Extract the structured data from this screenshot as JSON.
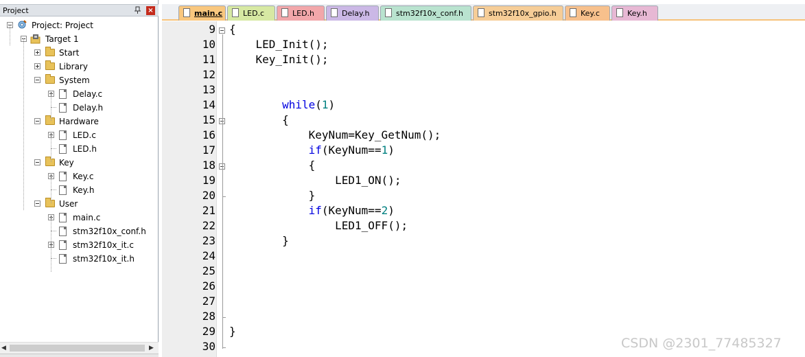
{
  "project_panel": {
    "title": "Project",
    "tree": [
      {
        "label": "Project: Project",
        "type": "project",
        "expanded": true
      },
      {
        "label": "Target 1",
        "type": "target",
        "expanded": true
      },
      {
        "label": "Start",
        "type": "folder",
        "expanded": false
      },
      {
        "label": "Library",
        "type": "folder",
        "expanded": false
      },
      {
        "label": "System",
        "type": "folder",
        "expanded": true
      },
      {
        "label": "Delay.c",
        "type": "file"
      },
      {
        "label": "Delay.h",
        "type": "file"
      },
      {
        "label": "Hardware",
        "type": "folder",
        "expanded": true
      },
      {
        "label": "LED.c",
        "type": "file"
      },
      {
        "label": "LED.h",
        "type": "file"
      },
      {
        "label": "Key",
        "type": "folder",
        "expanded": true
      },
      {
        "label": "Key.c",
        "type": "file"
      },
      {
        "label": "Key.h",
        "type": "file"
      },
      {
        "label": "User",
        "type": "folder",
        "expanded": true
      },
      {
        "label": "main.c",
        "type": "file"
      },
      {
        "label": "stm32f10x_conf.h",
        "type": "file"
      },
      {
        "label": "stm32f10x_it.c",
        "type": "file"
      },
      {
        "label": "stm32f10x_it.h",
        "type": "file"
      }
    ]
  },
  "tabs": [
    {
      "label": "main.c",
      "color": "#f9c77e",
      "active": true,
      "icon": "file-icon"
    },
    {
      "label": "LED.c",
      "color": "#d7e9a3",
      "icon": "file-icon"
    },
    {
      "label": "LED.h",
      "color": "#f2a7aa",
      "icon": "file-icon"
    },
    {
      "label": "Delay.h",
      "color": "#cbb8e6",
      "icon": "file-icon"
    },
    {
      "label": "stm32f10x_conf.h",
      "color": "#b9e3cf",
      "icon": "file-icon"
    },
    {
      "label": "stm32f10x_gpio.h",
      "color": "#f6cd97",
      "icon": "locked-file-icon"
    },
    {
      "label": "Key.c",
      "color": "#f7c08c",
      "icon": "file-icon"
    },
    {
      "label": "Key.h",
      "color": "#e7b8d4",
      "icon": "file-icon"
    }
  ],
  "editor": {
    "lines": [
      {
        "number": "9",
        "code": "{"
      },
      {
        "number": "10",
        "code": "    LED_Init();"
      },
      {
        "number": "11",
        "code": "    Key_Init();"
      },
      {
        "number": "12",
        "code": ""
      },
      {
        "number": "13",
        "code": ""
      },
      {
        "number": "14",
        "code": "        while(1)"
      },
      {
        "number": "15",
        "code": "        {"
      },
      {
        "number": "16",
        "code": "            KeyNum=Key_GetNum();"
      },
      {
        "number": "17",
        "code": "            if(KeyNum==1)"
      },
      {
        "number": "18",
        "code": "            {"
      },
      {
        "number": "19",
        "code": "                LED1_ON();"
      },
      {
        "number": "20",
        "code": "            }"
      },
      {
        "number": "21",
        "code": "            if(KeyNum==2)"
      },
      {
        "number": "22",
        "code": "                LED1_OFF();"
      },
      {
        "number": "23",
        "code": "        }"
      },
      {
        "number": "24",
        "code": ""
      },
      {
        "number": "25",
        "code": ""
      },
      {
        "number": "26",
        "code": ""
      },
      {
        "number": "27",
        "code": ""
      },
      {
        "number": "28",
        "code": ""
      },
      {
        "number": "29",
        "code": "}"
      },
      {
        "number": "30",
        "code": ""
      }
    ],
    "keyword_color": "#0000e0",
    "number_color": "#008080"
  },
  "watermark": "CSDN @2301_77485327"
}
